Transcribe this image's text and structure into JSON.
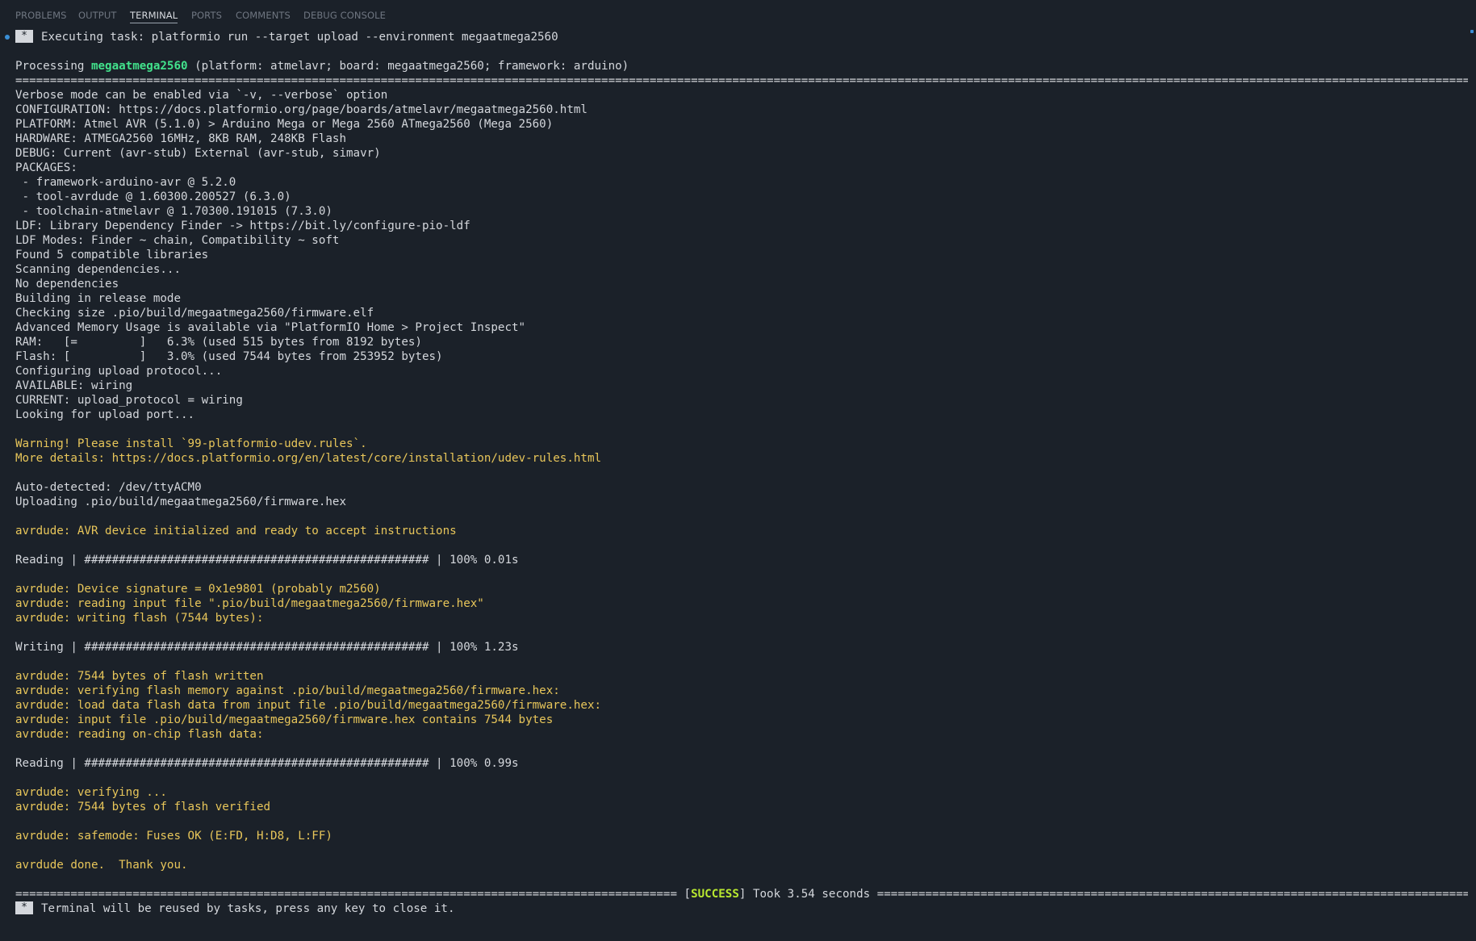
{
  "tabs": [
    {
      "label": "PROBLEMS",
      "active": false
    },
    {
      "label": "OUTPUT",
      "active": false
    },
    {
      "label": "TERMINAL",
      "active": true
    },
    {
      "label": "PORTS",
      "active": false
    },
    {
      "label": "COMMENTS",
      "active": false
    },
    {
      "label": "DEBUG CONSOLE",
      "active": false
    }
  ],
  "colors": {
    "background": "#1b2129",
    "text": "#d4d7dc",
    "warning": "#e8c65a",
    "env_highlight": "#42e28c",
    "success": "#b8e830",
    "accent": "#3a8fd6"
  },
  "terminal": {
    "task_icon": "*",
    "task_line": "Executing task: platformio run --target upload --environment megaatmega2560",
    "processing_prefix": "Processing ",
    "processing_env": "megaatmega2560",
    "processing_suffix": " (platform: atmelavr; board: megaatmega2560; framework: arduino)",
    "separator": "========================================================================================================================================================================================================================================",
    "info_lines": [
      "Verbose mode can be enabled via `-v, --verbose` option",
      "CONFIGURATION: https://docs.platformio.org/page/boards/atmelavr/megaatmega2560.html",
      "PLATFORM: Atmel AVR (5.1.0) > Arduino Mega or Mega 2560 ATmega2560 (Mega 2560)",
      "HARDWARE: ATMEGA2560 16MHz, 8KB RAM, 248KB Flash",
      "DEBUG: Current (avr-stub) External (avr-stub, simavr)",
      "PACKAGES:",
      " - framework-arduino-avr @ 5.2.0",
      " - tool-avrdude @ 1.60300.200527 (6.3.0)",
      " - toolchain-atmelavr @ 1.70300.191015 (7.3.0)",
      "LDF: Library Dependency Finder -> https://bit.ly/configure-pio-ldf",
      "LDF Modes: Finder ~ chain, Compatibility ~ soft",
      "Found 5 compatible libraries",
      "Scanning dependencies...",
      "No dependencies",
      "Building in release mode",
      "Checking size .pio/build/megaatmega2560/firmware.elf",
      "Advanced Memory Usage is available via \"PlatformIO Home > Project Inspect\"",
      "RAM:   [=         ]   6.3% (used 515 bytes from 8192 bytes)",
      "Flash: [          ]   3.0% (used 7544 bytes from 253952 bytes)",
      "Configuring upload protocol...",
      "AVAILABLE: wiring",
      "CURRENT: upload_protocol = wiring",
      "Looking for upload port..."
    ],
    "warning_lines": [
      "Warning! Please install `99-platformio-udev.rules`.",
      "More details: https://docs.platformio.org/en/latest/core/installation/udev-rules.html"
    ],
    "detect_lines": [
      "Auto-detected: /dev/ttyACM0",
      "Uploading .pio/build/megaatmega2560/firmware.hex"
    ],
    "avr_init": "avrdude: AVR device initialized and ready to accept instructions",
    "reading1": "Reading | ################################################## | 100% 0.01s",
    "sig_lines": [
      "avrdude: Device signature = 0x1e9801 (probably m2560)",
      "avrdude: reading input file \".pio/build/megaatmega2560/firmware.hex\"",
      "avrdude: writing flash (7544 bytes):"
    ],
    "writing": "Writing | ################################################## | 100% 1.23s",
    "verify_lines": [
      "avrdude: 7544 bytes of flash written",
      "avrdude: verifying flash memory against .pio/build/megaatmega2560/firmware.hex:",
      "avrdude: load data flash data from input file .pio/build/megaatmega2560/firmware.hex:",
      "avrdude: input file .pio/build/megaatmega2560/firmware.hex contains 7544 bytes",
      "avrdude: reading on-chip flash data:"
    ],
    "reading2": "Reading | ################################################## | 100% 0.99s",
    "verified_lines": [
      "avrdude: verifying ...",
      "avrdude: 7544 bytes of flash verified"
    ],
    "safemode": "avrdude: safemode: Fuses OK (E:FD, H:D8, L:FF)",
    "done": "avrdude done.  Thank you.",
    "success_left": "================================================================================================ [",
    "success_word": "SUCCESS",
    "success_right": "] Took 3.54 seconds ===============================================================================================",
    "reuse_line": "Terminal will be reused by tasks, press any key to close it."
  }
}
